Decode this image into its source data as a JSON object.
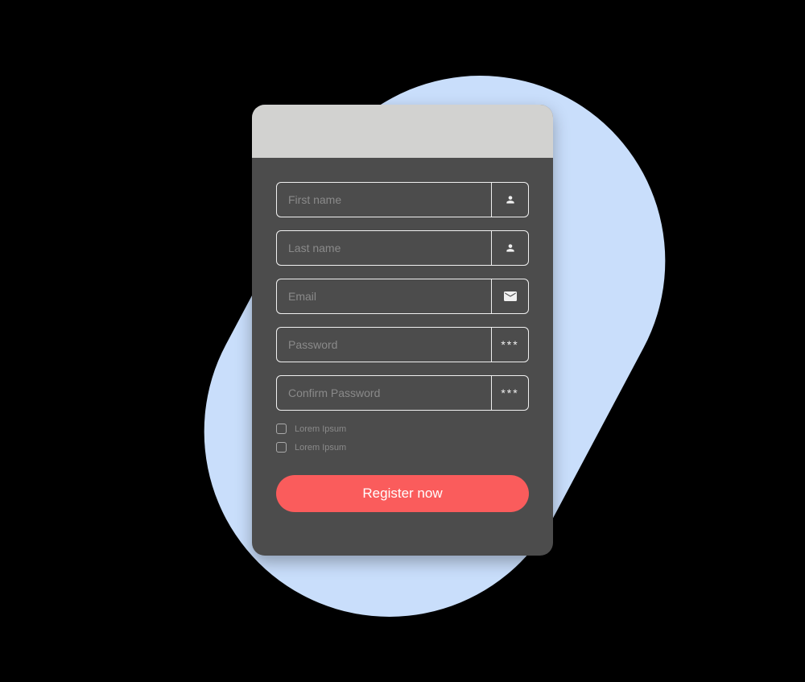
{
  "colors": {
    "blob": "#c9defb",
    "card_bg": "#4c4c4c",
    "header_bg": "#d2d2d0",
    "border": "#f0f0f0",
    "placeholder": "#8a8a8a",
    "button": "#fa5c5c",
    "button_text": "#ffffff"
  },
  "form": {
    "fields": {
      "first_name": {
        "placeholder": "First name",
        "value": "",
        "icon": "user-icon"
      },
      "last_name": {
        "placeholder": "Last name",
        "value": "",
        "icon": "user-icon"
      },
      "email": {
        "placeholder": "Email",
        "value": "",
        "icon": "mail-icon"
      },
      "password": {
        "placeholder": "Password",
        "value": "",
        "icon_text": "***"
      },
      "confirm_password": {
        "placeholder": "Confirm Password",
        "value": "",
        "icon_text": "***"
      }
    },
    "checkboxes": [
      {
        "label": "Lorem Ipsum",
        "checked": false
      },
      {
        "label": "Lorem Ipsum",
        "checked": false
      }
    ],
    "submit_label": "Register now"
  }
}
